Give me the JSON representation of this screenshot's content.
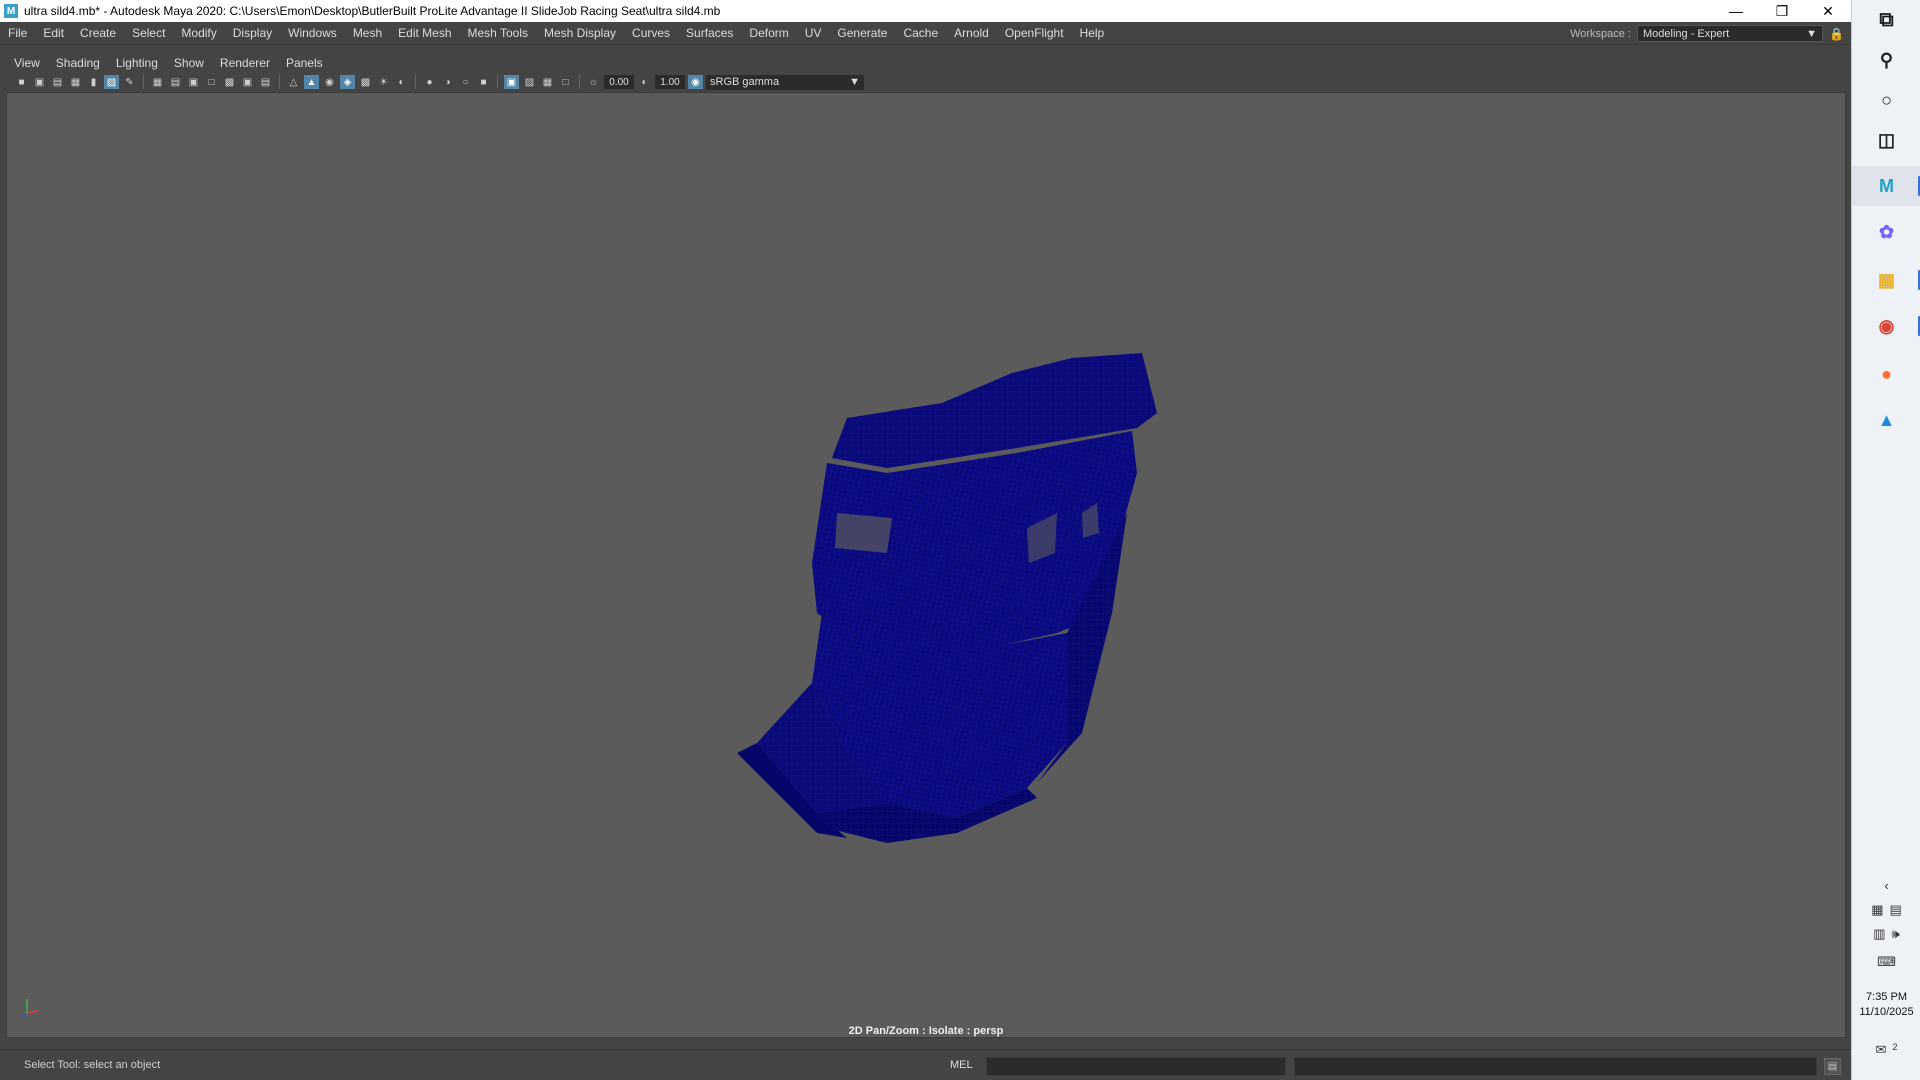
{
  "window": {
    "title": "ultra sild4.mb* - Autodesk Maya 2020: C:\\Users\\Emon\\Desktop\\ButlerBuilt ProLite Advantage II SlideJob Racing Seat\\ultra sild4.mb",
    "app_icon": "M",
    "minimize": "—",
    "restore": "❐",
    "close": "✕"
  },
  "menubar": {
    "items": [
      "File",
      "Edit",
      "Create",
      "Select",
      "Modify",
      "Display",
      "Windows",
      "Mesh",
      "Edit Mesh",
      "Mesh Tools",
      "Mesh Display",
      "Curves",
      "Surfaces",
      "Deform",
      "UV",
      "Generate",
      "Cache",
      "Arnold",
      "OpenFlight",
      "Help"
    ],
    "workspace_label": "Workspace :",
    "workspace_value": "Modeling - Expert"
  },
  "panel_menu": {
    "items": [
      "View",
      "Shading",
      "Lighting",
      "Show",
      "Renderer",
      "Panels"
    ]
  },
  "viewport_toolbar": {
    "exposure": "0.00",
    "gamma": "1.00",
    "color_space": "sRGB gamma"
  },
  "viewport": {
    "hud_label": "2D Pan/Zoom : Isolate : persp",
    "wireframe_color": "#0a0a7a",
    "background_color": "#5b5b5b"
  },
  "statusbar": {
    "help_line": "Select Tool: select an object",
    "mel_label": "MEL"
  },
  "taskbar": {
    "clock_time": "7:35 PM",
    "clock_date": "11/10/2025",
    "notification_count": "2"
  }
}
